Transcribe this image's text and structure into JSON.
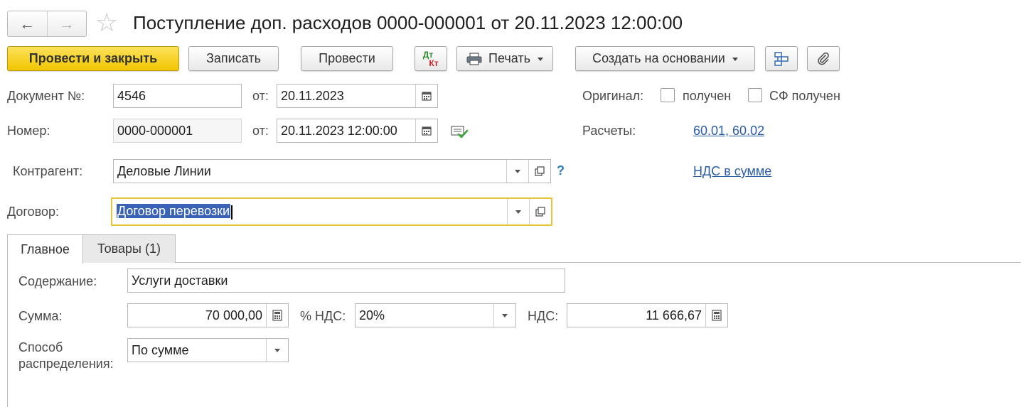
{
  "window": {
    "title": "Поступление доп. расходов 0000-000001 от 20.11.2023 12:00:00"
  },
  "toolbar": {
    "post_close": "Провести и закрыть",
    "save": "Записать",
    "post": "Провести",
    "dtkt_top": "Дт",
    "dtkt_bottom": "Кт",
    "print": "Печать",
    "create_based": "Создать на основании"
  },
  "form": {
    "doc_number_label": "Документ №:",
    "doc_number_value": "4546",
    "from_label": "от:",
    "doc_date_value": "20.11.2023",
    "number_label": "Номер:",
    "number_value": "0000-000001",
    "datetime_value": "20.11.2023 12:00:00",
    "contractor_label": "Контрагент:",
    "contractor_value": "Деловые Линии",
    "help_mark": "?",
    "contract_label": "Договор:",
    "contract_value": "Договор перевозки",
    "original_label": "Оригинал:",
    "received_label": "получен",
    "sf_received_label": "СФ получен",
    "settlements_label": "Расчеты:",
    "settlements_link": "60.01, 60.02",
    "vat_link": "НДС в сумме"
  },
  "tabs": [
    {
      "label": "Главное"
    },
    {
      "label": "Товары (1)"
    }
  ],
  "main": {
    "content_label": "Содержание:",
    "content_value": "Услуги доставки",
    "sum_label": "Сумма:",
    "sum_value": "70 000,00",
    "vat_rate_label": "% НДС:",
    "vat_rate_value": "20%",
    "vat_label": "НДС:",
    "vat_value": "11 666,67",
    "distribution_label_1": "Способ",
    "distribution_label_2": "распределения:",
    "distribution_value": "По сумме"
  },
  "colors": {
    "primary_button": "#f6d22c",
    "link": "#2a5ca8",
    "focus_border": "#e8c53a",
    "selection": "#3a63b8"
  }
}
